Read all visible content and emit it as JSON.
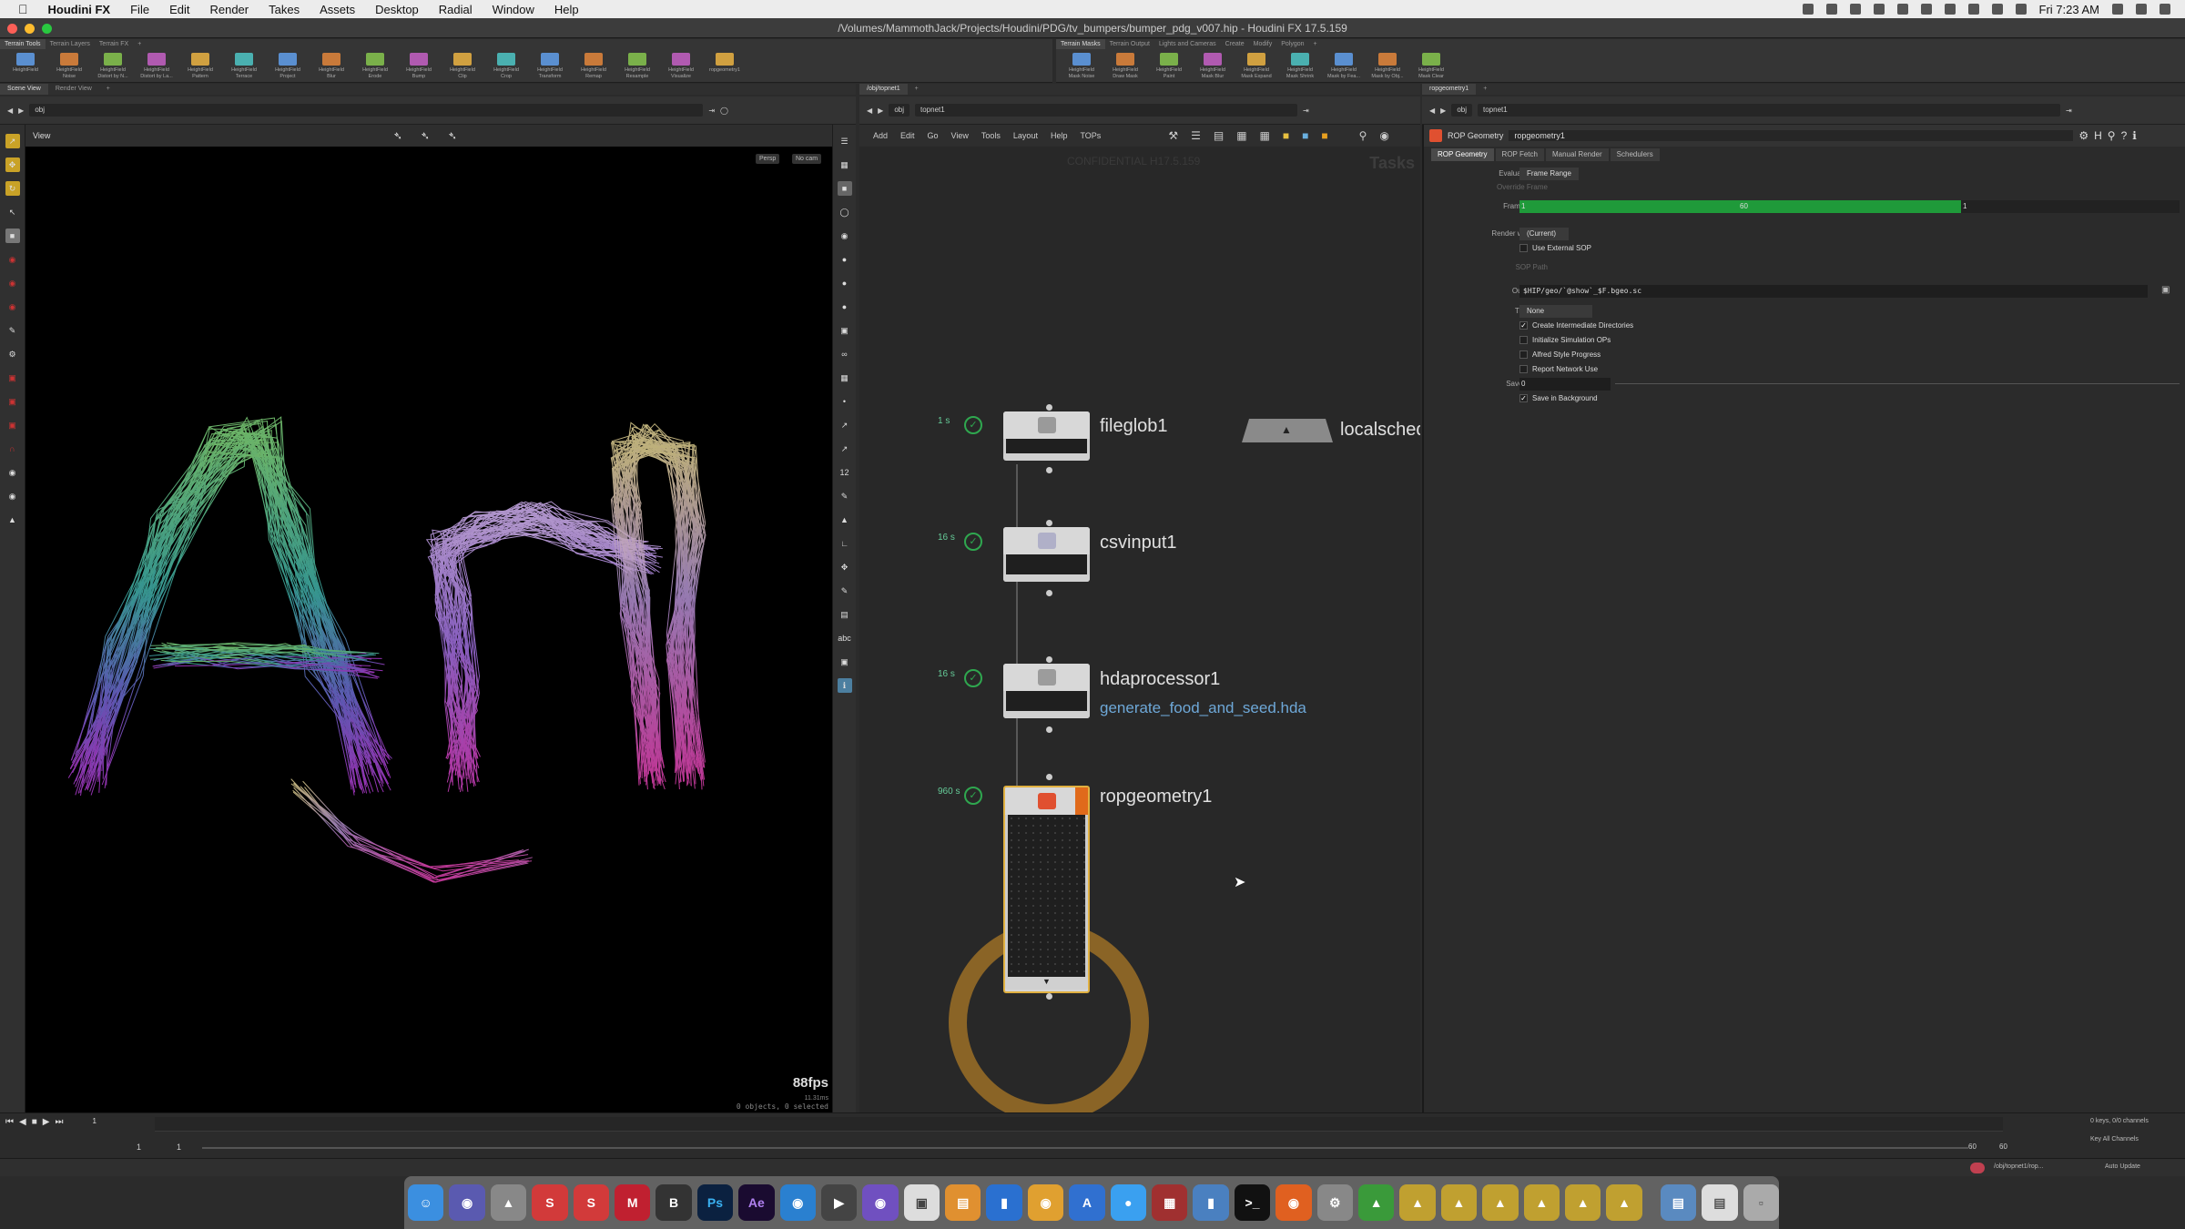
{
  "menubar": {
    "app": "Houdini FX",
    "items": [
      "File",
      "Edit",
      "Render",
      "Takes",
      "Assets",
      "Desktop",
      "Radial",
      "Window",
      "Help"
    ],
    "clock": "Fri 7:23 AM"
  },
  "window": {
    "title": "/Volumes/MammothJack/Projects/Houdini/PDG/tv_bumpers/bumper_pdg_v007.hip - Houdini FX 17.5.159"
  },
  "left_shelf": {
    "tabs": [
      "Terrain Tools",
      "Terrain Layers",
      "Terrain FX"
    ],
    "tools": [
      "HeightField",
      "HeightField\nNoise",
      "HeightField\nDistort by N...",
      "HeightField\nDistort by La...",
      "HeightField\nPattern",
      "HeightField\nTerrace",
      "HeightField\nProject",
      "HeightField\nBlur",
      "HeightField\nErode",
      "HeightField\nBump",
      "HeightField\nClip",
      "HeightField\nCrop",
      "HeightField\nTransform",
      "HeightField\nRemap",
      "HeightField\nResample",
      "HeightField\nVisualize",
      "ropgeometry1"
    ]
  },
  "right_shelf": {
    "tabs": [
      "Terrain Masks",
      "Terrain Output",
      "Lights and Cameras",
      "Create",
      "Modify",
      "Polygon"
    ],
    "tools": [
      "HeightField\nMask Noise",
      "HeightField\nDraw Mask",
      "HeightField\nPaint",
      "HeightField\nMask Blur",
      "HeightField\nMask Expand",
      "HeightField\nMask Shrink",
      "HeightField\nMask by Fea...",
      "HeightField\nMask by Obj...",
      "HeightField\nMask Clear"
    ]
  },
  "viewer": {
    "tabs": [
      "Scene View",
      "Render View"
    ],
    "path": "obj",
    "label": "View",
    "persp": "Persp",
    "cam": "No cam",
    "fps": "88fps",
    "fps_sub": "11.31ms",
    "stats": "0 objects, 0 selected"
  },
  "network": {
    "tab": "/obj/topnet1",
    "path_obj": "obj",
    "path_node": "topnet1",
    "menu": [
      "Add",
      "Edit",
      "Go",
      "View",
      "Tools",
      "Layout",
      "Help",
      "TOPs"
    ],
    "watermark": "CONFIDENTIAL H17.5.159",
    "tasks_label": "Tasks",
    "nodes": [
      {
        "name": "fileglob1",
        "time": "1 s",
        "sub": ""
      },
      {
        "name": "csvinput1",
        "time": "16 s",
        "sub": ""
      },
      {
        "name": "hdaprocessor1",
        "time": "16 s",
        "sub": "generate_food_and_seed.hda"
      },
      {
        "name": "ropgeometry1",
        "time": "960 s",
        "sub": ""
      }
    ],
    "scheduler": "localsched"
  },
  "parms": {
    "tab": "ropgeometry1",
    "path_obj": "obj",
    "path_node": "topnet1",
    "type": "ROP Geometry",
    "name": "ropgeometry1",
    "tabs": [
      "ROP Geometry",
      "ROP Fetch",
      "Manual Render",
      "Schedulers"
    ],
    "evaluate_label": "Evaluate Using",
    "evaluate_value": "Frame Range",
    "override_label": "Override Frame",
    "frame_range_label": "Frame Range",
    "frame_start": "1",
    "frame_end": "60",
    "frame_step": "1",
    "take_label": "Render with Take",
    "take_value": "(Current)",
    "use_ext_sop": "Use External SOP",
    "sop_path_label": "SOP Path",
    "output_label": "Output File",
    "output_value": "$HIP/geo/`@show`_$F.bgeo.sc",
    "transform_label": "Transform",
    "transform_value": "None",
    "checks": [
      {
        "label": "Create Intermediate Directories",
        "on": "✓"
      },
      {
        "label": "Initialize Simulation OPs",
        "on": ""
      },
      {
        "label": "Alfred Style Progress",
        "on": ""
      },
      {
        "label": "Report Network Use",
        "on": ""
      }
    ],
    "retries_label": "Save Retries",
    "retries_value": "0",
    "bg_label": "Save in Background",
    "bg_on": "✓"
  },
  "timeline": {
    "frame": "1",
    "start": "1",
    "start2": "1",
    "end": "60",
    "end2": "60",
    "keys": "0 keys, 0/0 channels",
    "channels": "Key All Channels",
    "status_path": "/obj/topnet1/rop...",
    "auto_update": "Auto Update"
  },
  "colors": {
    "accent_green": "#2fa74f",
    "frame_bar": "#1f9a3a",
    "rop_orange": "#e06a1b",
    "cook_ring": "#8a6426"
  }
}
